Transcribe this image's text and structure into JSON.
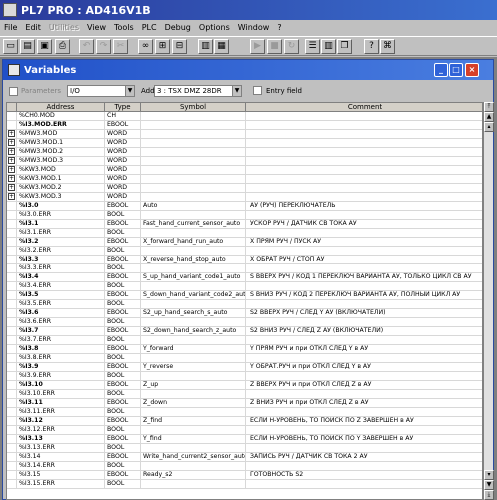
{
  "app": {
    "title": "PL7 PRO : AD416V1B"
  },
  "menu": [
    {
      "label": "File",
      "enabled": true
    },
    {
      "label": "Edit",
      "enabled": true
    },
    {
      "label": "Utilities",
      "enabled": false
    },
    {
      "label": "View",
      "enabled": true
    },
    {
      "label": "Tools",
      "enabled": true
    },
    {
      "label": "PLC",
      "enabled": true
    },
    {
      "label": "Debug",
      "enabled": true
    },
    {
      "label": "Options",
      "enabled": true
    },
    {
      "label": "Window",
      "enabled": true
    },
    {
      "label": "?",
      "enabled": true
    }
  ],
  "toolbar": [
    {
      "name": "new-icon",
      "glyph": "▭",
      "enabled": true
    },
    {
      "name": "open-icon",
      "glyph": "▤",
      "enabled": true
    },
    {
      "name": "save-icon",
      "glyph": "▣",
      "enabled": true
    },
    {
      "name": "print-icon",
      "glyph": "⎙",
      "enabled": true
    },
    {
      "name": "undo-icon",
      "glyph": "↶",
      "enabled": false
    },
    {
      "name": "redo-icon",
      "glyph": "↷",
      "enabled": false
    },
    {
      "name": "cut-icon",
      "glyph": "✂",
      "enabled": false
    },
    {
      "name": "binoculars-icon",
      "glyph": "∞",
      "enabled": true
    },
    {
      "name": "find-icon",
      "glyph": "⊞",
      "enabled": true
    },
    {
      "name": "replace-icon",
      "glyph": "⊟",
      "enabled": true
    },
    {
      "name": "variables-icon",
      "glyph": "▥",
      "enabled": true
    },
    {
      "name": "plc-icon",
      "glyph": "▦",
      "enabled": true
    },
    {
      "name": "run-icon",
      "glyph": "▶",
      "enabled": false
    },
    {
      "name": "stop-icon",
      "glyph": "■",
      "enabled": false
    },
    {
      "name": "init-icon",
      "glyph": "↻",
      "enabled": false
    },
    {
      "name": "tile-horizontal-icon",
      "glyph": "☰",
      "enabled": true
    },
    {
      "name": "tile-vertical-icon",
      "glyph": "▥",
      "enabled": true
    },
    {
      "name": "cascade-icon",
      "glyph": "❐",
      "enabled": true
    },
    {
      "name": "help-icon",
      "glyph": "?",
      "enabled": true
    },
    {
      "name": "context-help-icon",
      "glyph": "⌘",
      "enabled": true
    }
  ],
  "variables_window": {
    "title": "Variables",
    "parameters_label": "Parameters",
    "filter_value": "I/O",
    "add_label": "Add",
    "add_value": "3 : TSX DMZ 28DR",
    "entry_field_label": "Entry field",
    "columns": [
      "Address",
      "Type",
      "Symbol",
      "Comment"
    ],
    "rows": [
      {
        "exp": "",
        "addr": "%CH0.MOD",
        "type": "CH",
        "symbol": "",
        "comment": "",
        "bold": false
      },
      {
        "exp": "",
        "addr": "%I3.MOD.ERR",
        "type": "EBOOL",
        "symbol": "",
        "comment": "",
        "bold": true
      },
      {
        "exp": "+",
        "addr": "%MW3.MOD",
        "type": "WORD",
        "symbol": "",
        "comment": "",
        "bold": false
      },
      {
        "exp": "+",
        "addr": "%MW3.MOD.1",
        "type": "WORD",
        "symbol": "",
        "comment": "",
        "bold": false
      },
      {
        "exp": "+",
        "addr": "%MW3.MOD.2",
        "type": "WORD",
        "symbol": "",
        "comment": "",
        "bold": false
      },
      {
        "exp": "+",
        "addr": "%MW3.MOD.3",
        "type": "WORD",
        "symbol": "",
        "comment": "",
        "bold": false
      },
      {
        "exp": "+",
        "addr": "%KW3.MOD",
        "type": "WORD",
        "symbol": "",
        "comment": "",
        "bold": false
      },
      {
        "exp": "+",
        "addr": "%KW3.MOD.1",
        "type": "WORD",
        "symbol": "",
        "comment": "",
        "bold": false
      },
      {
        "exp": "+",
        "addr": "%KW3.MOD.2",
        "type": "WORD",
        "symbol": "",
        "comment": "",
        "bold": false
      },
      {
        "exp": "+",
        "addr": "%KW3.MOD.3",
        "type": "WORD",
        "symbol": "",
        "comment": "",
        "bold": false
      },
      {
        "exp": "",
        "addr": "%I3.0",
        "type": "EBOOL",
        "symbol": "Auto",
        "comment": "АУ (РУЧ) ПЕРЕКЛЮЧАТЕЛЬ",
        "bold": true
      },
      {
        "exp": "",
        "addr": "%I3.0.ERR",
        "type": "BOOL",
        "symbol": "",
        "comment": "",
        "bold": false
      },
      {
        "exp": "",
        "addr": "%I3.1",
        "type": "EBOOL",
        "symbol": "Fast_hand_current_sensor_auto",
        "comment": "УСКОР РУЧ / ДАТЧИК СВ ТОКА АУ",
        "bold": true
      },
      {
        "exp": "",
        "addr": "%I3.1.ERR",
        "type": "BOOL",
        "symbol": "",
        "comment": "",
        "bold": false
      },
      {
        "exp": "",
        "addr": "%I3.2",
        "type": "EBOOL",
        "symbol": "X_forward_hand_run_auto",
        "comment": "Х ПРЯМ РУЧ / ПУСК АУ",
        "bold": true
      },
      {
        "exp": "",
        "addr": "%I3.2.ERR",
        "type": "BOOL",
        "symbol": "",
        "comment": "",
        "bold": false
      },
      {
        "exp": "",
        "addr": "%I3.3",
        "type": "EBOOL",
        "symbol": "X_reverse_hand_stop_auto",
        "comment": "Х ОБРАТ РУЧ / СТОП АУ",
        "bold": true
      },
      {
        "exp": "",
        "addr": "%I3.3.ERR",
        "type": "BOOL",
        "symbol": "",
        "comment": "",
        "bold": false
      },
      {
        "exp": "",
        "addr": "%I3.4",
        "type": "EBOOL",
        "symbol": "S_up_hand_variant_code1_auto",
        "comment": "S ВВЕРХ РУЧ / КОД 1 ПЕРЕКЛЮЧ ВАРИАНТА АУ, ТОЛЬКО ЦИКЛ СВ АУ",
        "bold": true
      },
      {
        "exp": "",
        "addr": "%I3.4.ERR",
        "type": "BOOL",
        "symbol": "",
        "comment": "",
        "bold": false
      },
      {
        "exp": "",
        "addr": "%I3.5",
        "type": "EBOOL",
        "symbol": "S_down_hand_variant_code2_auto",
        "comment": "S ВНИЗ РУЧ / КОД 2 ПЕРЕКЛЮЧ ВАРИАНТА АУ, ПОЛНЫЙ ЦИКЛ АУ",
        "bold": true
      },
      {
        "exp": "",
        "addr": "%I3.5.ERR",
        "type": "BOOL",
        "symbol": "",
        "comment": "",
        "bold": false
      },
      {
        "exp": "",
        "addr": "%I3.6",
        "type": "EBOOL",
        "symbol": "S2_up_hand_search_s_auto",
        "comment": "S2 ВВЕРХ РУЧ / СЛЕД Y АУ (ВКЛЮЧАТЕЛИ)",
        "bold": true
      },
      {
        "exp": "",
        "addr": "%I3.6.ERR",
        "type": "BOOL",
        "symbol": "",
        "comment": "",
        "bold": false
      },
      {
        "exp": "",
        "addr": "%I3.7",
        "type": "EBOOL",
        "symbol": "S2_down_hand_search_z_auto",
        "comment": "S2 ВНИЗ РУЧ / СЛЕД Z АУ (ВКЛЮЧАТЕЛИ)",
        "bold": true
      },
      {
        "exp": "",
        "addr": "%I3.7.ERR",
        "type": "BOOL",
        "symbol": "",
        "comment": "",
        "bold": false
      },
      {
        "exp": "",
        "addr": "%I3.8",
        "type": "EBOOL",
        "symbol": "Y_forward",
        "comment": "Y ПРЯМ РУЧ и при ОТКЛ СЛЕД Y в АУ",
        "bold": true
      },
      {
        "exp": "",
        "addr": "%I3.8.ERR",
        "type": "BOOL",
        "symbol": "",
        "comment": "",
        "bold": false
      },
      {
        "exp": "",
        "addr": "%I3.9",
        "type": "EBOOL",
        "symbol": "Y_reverse",
        "comment": "Y ОБРАТ.РУЧ и при ОТКЛ СЛЕД Y в АУ",
        "bold": true
      },
      {
        "exp": "",
        "addr": "%I3.9.ERR",
        "type": "BOOL",
        "symbol": "",
        "comment": "",
        "bold": false
      },
      {
        "exp": "",
        "addr": "%I3.10",
        "type": "EBOOL",
        "symbol": "Z_up",
        "comment": "Z ВВЕРХ РУЧ и при ОТКЛ СЛЕД Z в АУ",
        "bold": true
      },
      {
        "exp": "",
        "addr": "%I3.10.ERR",
        "type": "BOOL",
        "symbol": "",
        "comment": "",
        "bold": false
      },
      {
        "exp": "",
        "addr": "%I3.11",
        "type": "EBOOL",
        "symbol": "Z_down",
        "comment": "Z ВНИЗ РУЧ и при ОТКЛ СЛЕД Z в АУ",
        "bold": true
      },
      {
        "exp": "",
        "addr": "%I3.11.ERR",
        "type": "BOOL",
        "symbol": "",
        "comment": "",
        "bold": false
      },
      {
        "exp": "",
        "addr": "%I3.12",
        "type": "EBOOL",
        "symbol": "Z_find",
        "comment": "ЕСЛИ Н-УРОВЕНЬ, ТО ПОИСК ПО Z ЗАВЕРШЕН в АУ",
        "bold": true
      },
      {
        "exp": "",
        "addr": "%I3.12.ERR",
        "type": "BOOL",
        "symbol": "",
        "comment": "",
        "bold": false
      },
      {
        "exp": "",
        "addr": "%I3.13",
        "type": "EBOOL",
        "symbol": "Y_find",
        "comment": "ЕСЛИ Н-УРОВЕНЬ, ТО ПОИСК ПО Y ЗАВЕРШЕН в АУ",
        "bold": true
      },
      {
        "exp": "",
        "addr": "%I3.13.ERR",
        "type": "BOOL",
        "symbol": "",
        "comment": "",
        "bold": false
      },
      {
        "exp": "",
        "addr": "%I3.14",
        "type": "EBOOL",
        "symbol": "Write_hand_current2_sensor_auto",
        "comment": "ЗАПИСЬ РУЧ / ДАТЧИК СВ ТОКА 2 АУ",
        "bold": false
      },
      {
        "exp": "",
        "addr": "%I3.14.ERR",
        "type": "BOOL",
        "symbol": "",
        "comment": "",
        "bold": false
      },
      {
        "exp": "",
        "addr": "%I3.15",
        "type": "EBOOL",
        "symbol": "Ready_s2",
        "comment": "ГОТОВНОСТЬ S2",
        "bold": false
      },
      {
        "exp": "",
        "addr": "%I3.15.ERR",
        "type": "BOOL",
        "symbol": "",
        "comment": "",
        "bold": false
      }
    ]
  }
}
